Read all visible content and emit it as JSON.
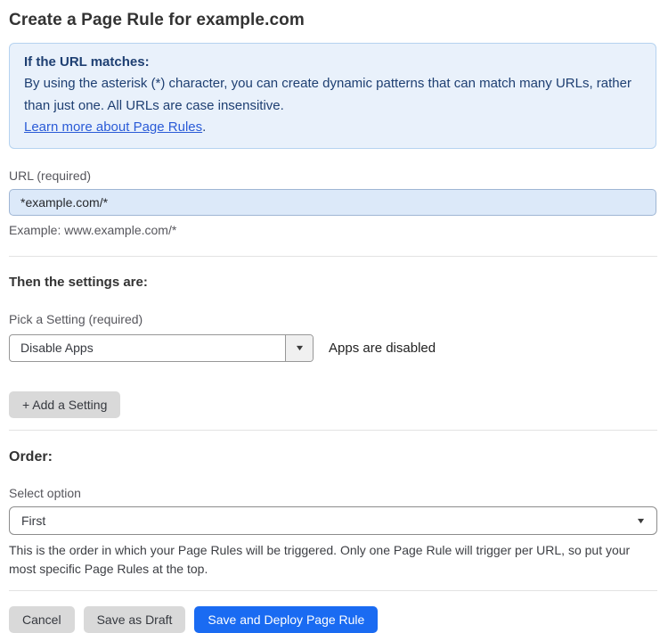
{
  "page": {
    "title": "Create a Page Rule for example.com"
  },
  "info_box": {
    "heading": "If the URL matches:",
    "body": "By using the asterisk (*) character, you can create dynamic patterns that can match many URLs, rather than just one. All URLs are case insensitive.",
    "link_label": "Learn more about Page Rules",
    "link_suffix": "."
  },
  "url_field": {
    "label": "URL (required)",
    "value": "*example.com/*",
    "helper": "Example: www.example.com/*"
  },
  "settings_section": {
    "heading": "Then the settings are:",
    "picker_label": "Pick a Setting (required)",
    "picker_value": "Disable Apps",
    "picker_status": "Apps are disabled",
    "add_setting_label": "+ Add a Setting"
  },
  "order_section": {
    "heading": "Order:",
    "select_label": "Select option",
    "select_value": "First",
    "helper": "This is the order in which your Page Rules will be triggered. Only one Page Rule will trigger per URL, so put your most specific Page Rules at the top."
  },
  "actions": {
    "cancel_label": "Cancel",
    "save_draft_label": "Save as Draft",
    "save_deploy_label": "Save and Deploy Page Rule"
  },
  "icons": {
    "caret_down": "▼"
  },
  "colors": {
    "primary_button": "#1a6bf2",
    "secondary_button": "#d9d9d9",
    "info_box_bg": "#e9f1fb",
    "info_box_border": "#b6d3f0",
    "info_text": "#1e3f72",
    "link": "#2a5bd7",
    "url_input_bg": "#dce9f9",
    "url_input_border": "#9fb6d4"
  }
}
